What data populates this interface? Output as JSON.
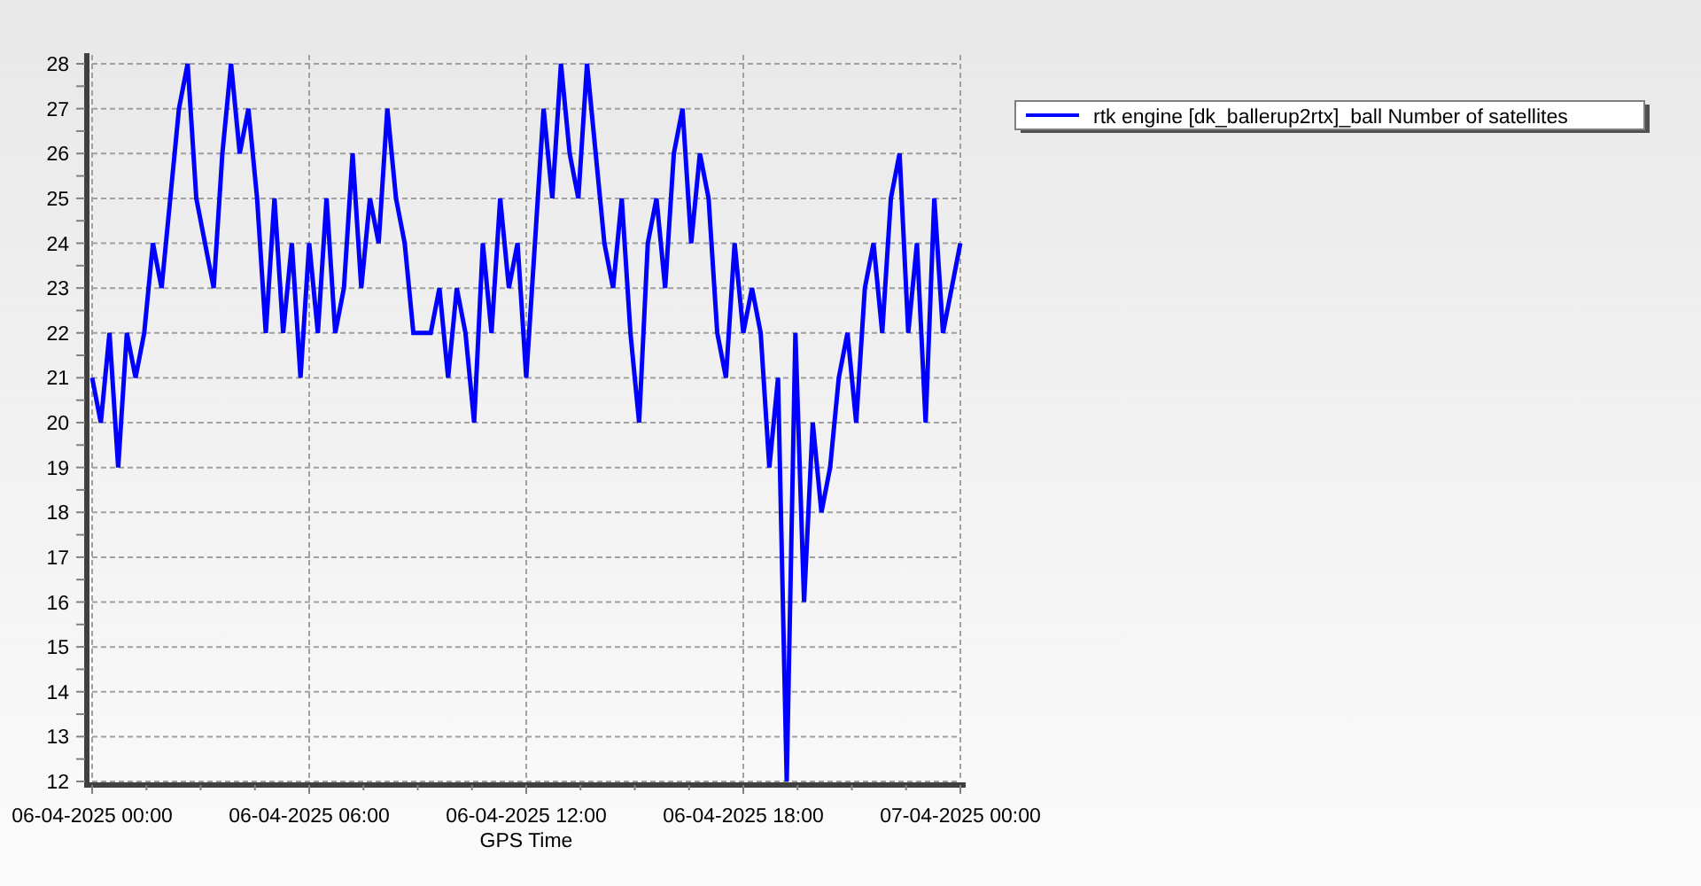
{
  "chart_data": {
    "type": "line",
    "grid": true,
    "xlabel": "GPS Time",
    "ylim": [
      12,
      28
    ],
    "yticks": [
      12,
      13,
      14,
      15,
      16,
      17,
      18,
      19,
      20,
      21,
      22,
      23,
      24,
      25,
      26,
      27,
      28
    ],
    "categories": [
      "06-04-2025 00:00",
      null,
      null,
      null,
      null,
      null,
      null,
      null,
      null,
      null,
      null,
      null,
      null,
      null,
      null,
      null,
      null,
      null,
      null,
      null,
      null,
      null,
      null,
      null,
      null,
      "06-04-2025 06:00",
      null,
      null,
      null,
      null,
      null,
      null,
      null,
      null,
      null,
      null,
      null,
      null,
      null,
      null,
      null,
      null,
      null,
      null,
      null,
      null,
      null,
      null,
      null,
      null,
      "06-04-2025 12:00",
      null,
      null,
      null,
      null,
      null,
      null,
      null,
      null,
      null,
      null,
      null,
      null,
      null,
      null,
      null,
      null,
      null,
      null,
      null,
      null,
      null,
      null,
      null,
      null,
      "06-04-2025 18:00",
      null,
      null,
      null,
      null,
      null,
      null,
      null,
      null,
      null,
      null,
      null,
      null,
      null,
      null,
      null,
      null,
      null,
      null,
      null,
      null,
      null,
      null,
      null,
      null,
      "07-04-2025 00:00"
    ],
    "series": [
      {
        "name": "rtk engine [dk_ballerup2rtx]_ball Number of satellites",
        "color": "#0000ff",
        "values": [
          21,
          20,
          22,
          19,
          22,
          21,
          22,
          24,
          23,
          25,
          27,
          28,
          25,
          24,
          23,
          26,
          28,
          26,
          27,
          25,
          22,
          25,
          22,
          24,
          21,
          24,
          22,
          25,
          22,
          23,
          26,
          23,
          25,
          24,
          27,
          25,
          24,
          22,
          22,
          22,
          23,
          21,
          23,
          22,
          20,
          24,
          22,
          25,
          23,
          24,
          21,
          24,
          27,
          25,
          28,
          26,
          25,
          28,
          26,
          24,
          23,
          25,
          22,
          20,
          24,
          25,
          23,
          26,
          27,
          24,
          26,
          25,
          22,
          21,
          24,
          22,
          23,
          22,
          19,
          21,
          12,
          22,
          16,
          20,
          18,
          19,
          21,
          22,
          20,
          23,
          24,
          22,
          25,
          26,
          22,
          24,
          20,
          25,
          22,
          23,
          24
        ]
      }
    ]
  }
}
